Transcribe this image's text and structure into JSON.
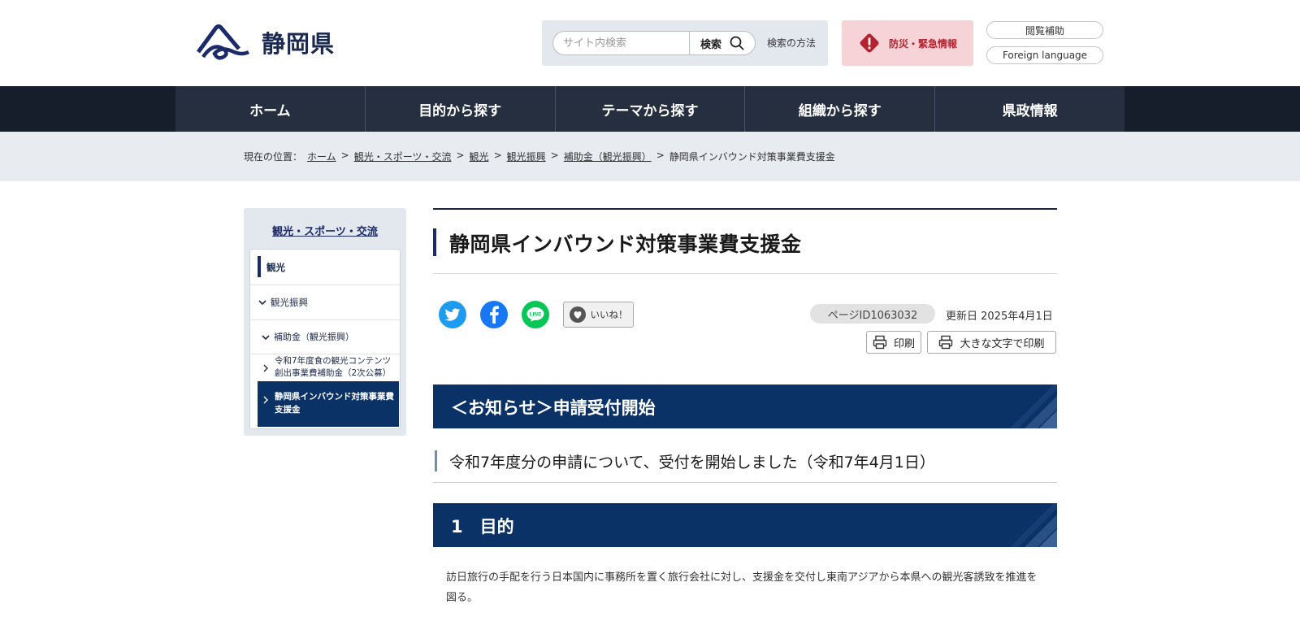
{
  "header": {
    "site_name": "静岡県",
    "search": {
      "placeholder": "サイト内検索",
      "button_label": "検索",
      "help_link": "検索の方法"
    },
    "emergency_label": "防災・緊急情報",
    "accessibility_label": "閲覧補助",
    "language_label": "Foreign language"
  },
  "nav": {
    "items": [
      "ホーム",
      "目的から探す",
      "テーマから探す",
      "組織から探す",
      "県政情報"
    ]
  },
  "breadcrumb": {
    "prefix": "現在の位置：",
    "items": [
      "ホーム",
      "観光・スポーツ・交流",
      "観光",
      "観光振興",
      "補助金（観光振興）"
    ],
    "current": "静岡県インバウンド対策事業費支援金",
    "separator": ">"
  },
  "sidebar": {
    "title": "観光・スポーツ・交流",
    "items": [
      "観光",
      "観光振興",
      "補助金（観光振興）",
      "令和7年度食の観光コンテンツ創出事業費補助金（2次公募）",
      "静岡県インバウンド対策事業費支援金"
    ]
  },
  "page": {
    "title": "静岡県インバウンド対策事業費支援金",
    "like_label": "いいね！",
    "page_id": "ページID1063032",
    "updated": "更新日 2025年4月1日",
    "print_label": "印刷",
    "print_large_label": "大きな文字で印刷",
    "notice_heading": "＜お知らせ＞申請受付開始",
    "notice_text": "令和7年度分の申請について、受付を開始しました（令和7年4月1日）",
    "section1_heading": "1　目的",
    "section1_text": "訪日旅行の手配を行う日本国内に事務所を置く旅行会社に対し、支援金を交付し東南アジアから本県への観光客誘致を推進を図る。"
  },
  "colors": {
    "nav_bg": "#262f3f",
    "heading_bg": "#0b3266",
    "emergency_bg": "#f6d3d6",
    "emergency_text": "#b3222e",
    "twitter": "#1d9bf0",
    "facebook": "#1877f2",
    "line": "#06c755"
  }
}
